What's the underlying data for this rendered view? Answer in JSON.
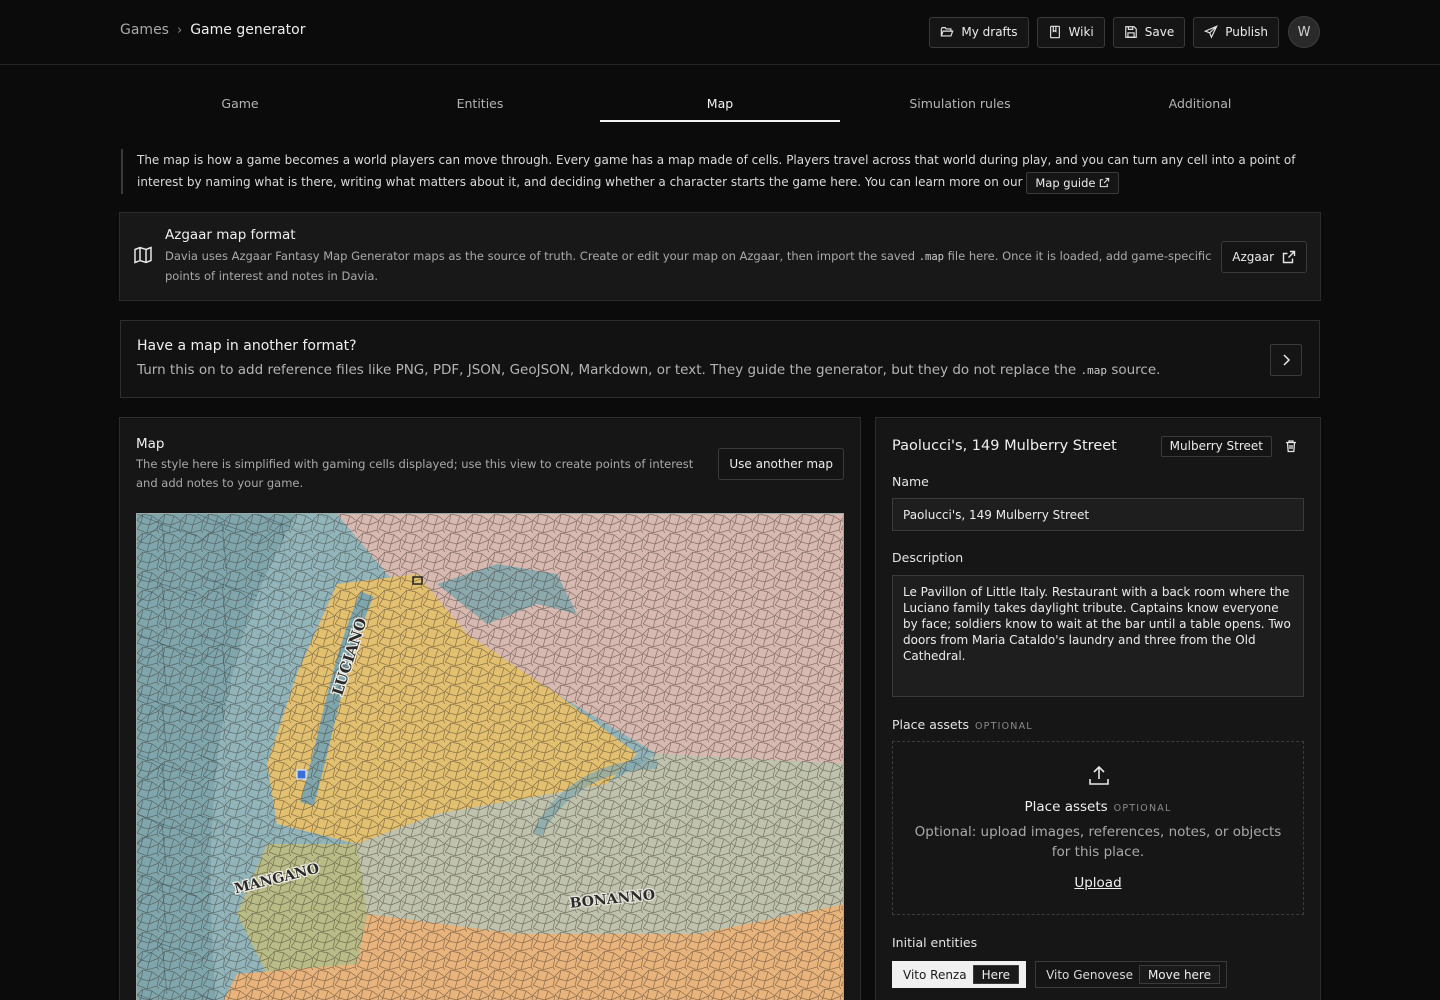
{
  "breadcrumb": {
    "root": "Games",
    "current": "Game generator"
  },
  "actions": {
    "drafts": "My drafts",
    "wiki": "Wiki",
    "save": "Save",
    "publish": "Publish",
    "avatar": "W"
  },
  "tabs": [
    "Game",
    "Entities",
    "Map",
    "Simulation rules",
    "Additional"
  ],
  "active_tab": "Map",
  "intro": {
    "text": "The map is how a game becomes a world players can move through. Every game has a map made of cells. Players travel across that world during play, and you can turn any cell into a point of interest by naming what is there, writing what matters about it, and deciding whether a character starts the game here. You can learn more on our",
    "guide_label": "Map guide"
  },
  "azgaar": {
    "title": "Azgaar map format",
    "desc_a": "Davia uses Azgaar Fantasy Map Generator maps as the source of truth. Create or edit your map on Azgaar, then import the saved",
    "desc_code": ".map",
    "desc_b": "file here. Once it is loaded, add game-specific points of interest and notes in Davia.",
    "button": "Azgaar"
  },
  "other_format": {
    "title": "Have a map in another format?",
    "desc_a": "Turn this on to add reference files like PNG, PDF, JSON, GeoJSON, Markdown, or text. They guide the generator, but they do not replace the",
    "desc_code": ".map",
    "desc_b": "source."
  },
  "map_panel": {
    "title": "Map",
    "desc": "The style here is simplified with gaming cells displayed; use this view to create points of interest and add notes to your game.",
    "button": "Use another map",
    "labels": [
      "LUCIANO",
      "MANGANO",
      "BONANNO"
    ],
    "colors": {
      "water": "#7fa6ad",
      "luciano": "#e3c06f",
      "north": "#d8b9b1",
      "bonanno": "#bfc3ad",
      "south": "#e8b47c",
      "mangano": "#b9bc86"
    }
  },
  "place": {
    "title": "Paolucci's, 149 Mulberry Street",
    "tag": "Mulberry Street",
    "name_label": "Name",
    "name_value": "Paolucci's, 149 Mulberry Street",
    "desc_label": "Description",
    "desc_value": "Le Pavillon of Little Italy. Restaurant with a back room where the Luciano family takes daylight tribute. Captains know everyone by face; soldiers know to wait at the bar until a table opens. Two doors from Maria Cataldo's laundry and three from the Old Cathedral.",
    "assets_label": "Place assets",
    "optional": "OPTIONAL",
    "drop_title": "Place assets",
    "drop_desc": "Optional: upload images, references, notes, or objects for this place.",
    "upload": "Upload",
    "entities_label": "Initial entities",
    "entities": [
      {
        "name": "Vito Renza",
        "action": "Here",
        "selected": true
      },
      {
        "name": "Vito Genovese",
        "action": "Move here",
        "selected": false
      }
    ]
  }
}
